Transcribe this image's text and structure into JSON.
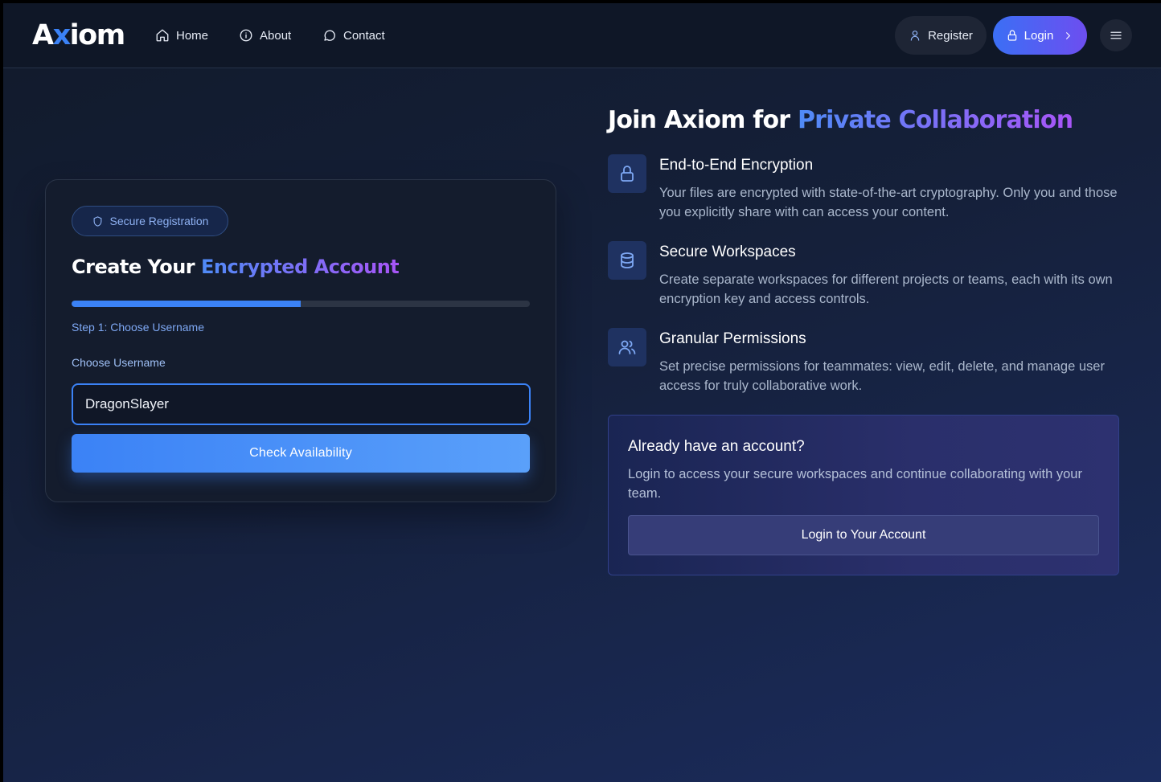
{
  "nav": {
    "logo_prefix": "A",
    "logo_x": "x",
    "logo_suffix": "iom",
    "links": [
      {
        "label": "Home",
        "icon": "home-icon"
      },
      {
        "label": "About",
        "icon": "info-icon"
      },
      {
        "label": "Contact",
        "icon": "chat-bubble-icon"
      }
    ],
    "register_label": "Register",
    "login_label": "Login"
  },
  "registration": {
    "badge_label": "Secure Registration",
    "title_plain": "Create Your ",
    "title_accent": "Encrypted Account",
    "progress": 0.5,
    "step_label": "Step 1: Choose Username",
    "field_label": "Choose Username",
    "username_value": "DragonSlayer",
    "check_button_label": "Check Availability"
  },
  "join": {
    "title_plain": "Join Axiom for ",
    "title_accent": "Private Collaboration",
    "features": [
      {
        "icon": "lock-icon",
        "title": "End-to-End Encryption",
        "description": "Your files are encrypted with state-of-the-art cryptography. Only you and those you explicitly share with can access your content."
      },
      {
        "icon": "database-icon",
        "title": "Secure Workspaces",
        "description": "Create separate workspaces for different projects or teams, each with its own encryption key and access controls."
      },
      {
        "icon": "users-icon",
        "title": "Granular Permissions",
        "description": "Set precise permissions for teammates: view, edit, delete, and manage user access for truly collaborative work."
      }
    ]
  },
  "login_card": {
    "title": "Already have an account?",
    "description": "Login to access your secure workspaces and continue collaborating with your team.",
    "button_label": "Login to Your Account"
  },
  "colors": {
    "accent": "#3b82f6",
    "accent_purple": "#a855f7",
    "background": "#111a2b"
  }
}
